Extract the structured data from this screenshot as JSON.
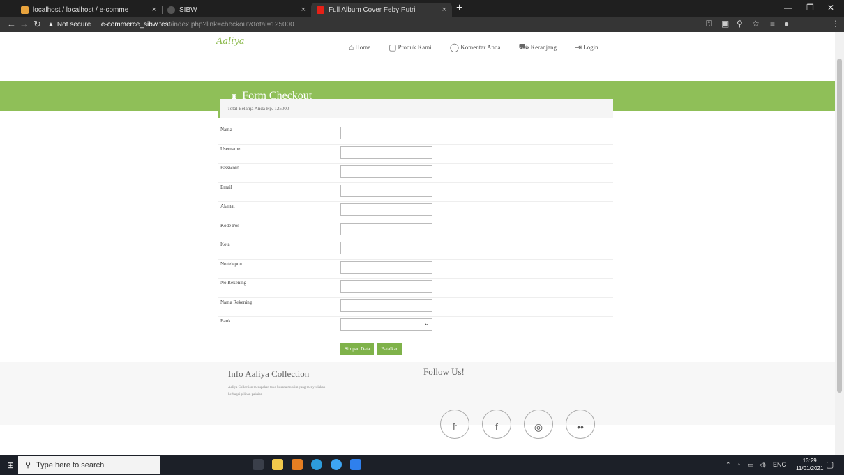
{
  "browser": {
    "tabs": [
      {
        "title": "localhost / localhost / e-comme"
      },
      {
        "title": "SIBW"
      },
      {
        "title": "Full Album Cover Feby Putri"
      }
    ],
    "new_tab": "+",
    "close_glyph": "×",
    "address": {
      "security": "Not secure",
      "host": "e-commerce_sibw.test",
      "path": "/index.php?link=checkout&total=125000"
    }
  },
  "site": {
    "logo": "Aaliya",
    "nav": [
      {
        "label": "Home",
        "icon": "home-icon"
      },
      {
        "label": "Produk Kami",
        "icon": "bag-icon"
      },
      {
        "label": "Komentar Anda",
        "icon": "comment-icon"
      },
      {
        "label": "Keranjang",
        "icon": "cart-icon"
      },
      {
        "label": "Login",
        "icon": "login-icon"
      }
    ],
    "banner_title": "Form Checkout",
    "notice": "Total Belanja Anda Rp. 125000",
    "fields": [
      {
        "label": "Nama",
        "value": ""
      },
      {
        "label": "Username",
        "value": ""
      },
      {
        "label": "Password",
        "value": ""
      },
      {
        "label": "Email",
        "value": ""
      },
      {
        "label": "Alamat",
        "value": ""
      },
      {
        "label": "Kode Pos",
        "value": ""
      },
      {
        "label": "Kota",
        "value": ""
      },
      {
        "label": "No telepon",
        "value": ""
      },
      {
        "label": "No Rekening",
        "value": ""
      },
      {
        "label": "Nama Rekening",
        "value": ""
      }
    ],
    "bank": {
      "label": "Bank",
      "value": ""
    },
    "buttons": {
      "save": "Simpan Data",
      "reset": "Batalkan"
    },
    "footer": {
      "info_title": "Info Aaliya Collection",
      "info_text": "Aaliya Collection merupakan toko busana muslim yang menyediakan berbagai pilihan pakaian",
      "follow_title": "Follow Us!"
    }
  },
  "taskbar": {
    "search_placeholder": "Type here to search",
    "lang": "ENG",
    "time": "13:29",
    "date": "11/01/2021"
  }
}
